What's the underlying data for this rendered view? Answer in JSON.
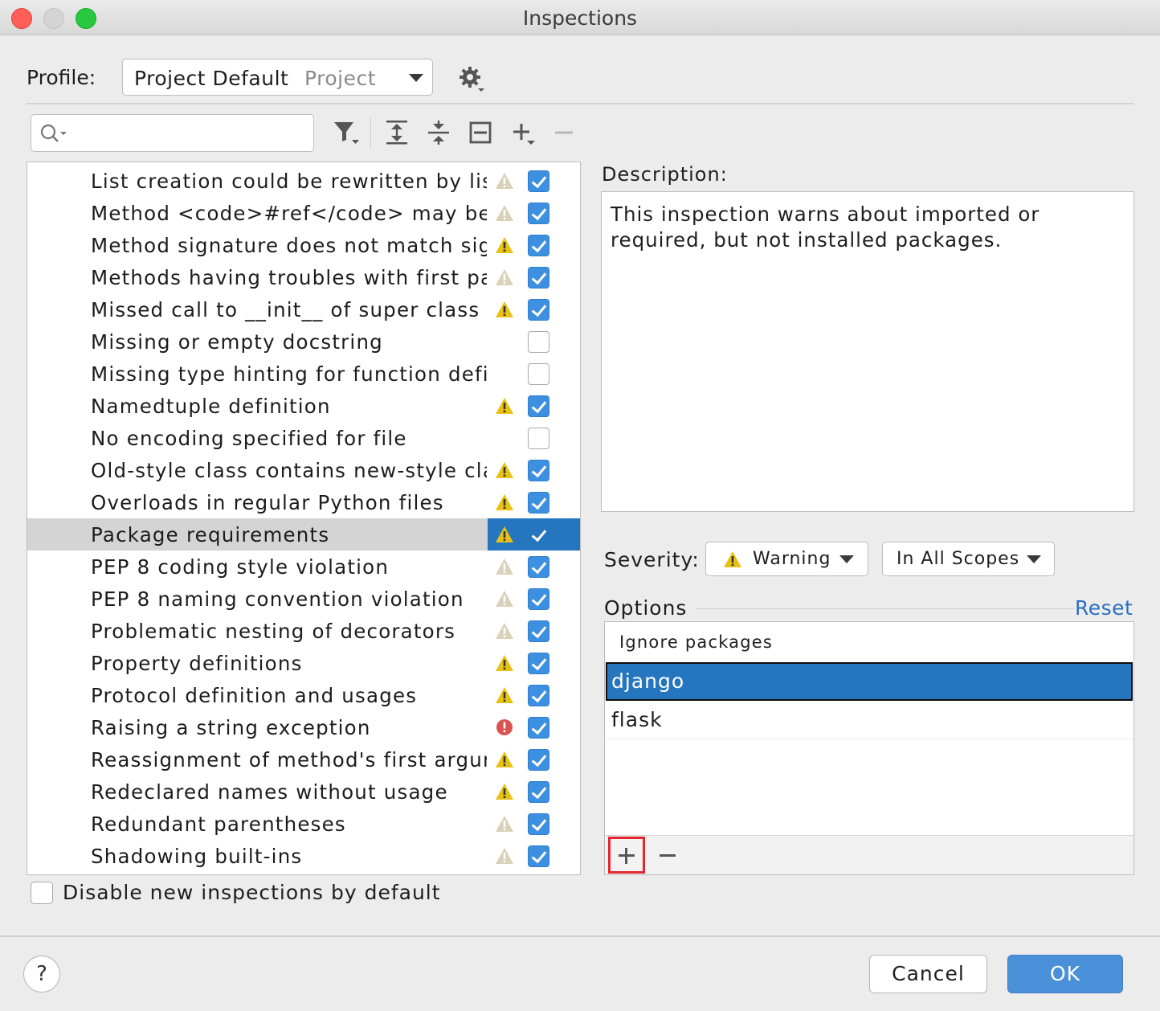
{
  "window": {
    "title": "Inspections"
  },
  "profile": {
    "label": "Profile:",
    "value": "Project Default",
    "scope": "Project"
  },
  "toolbar": {
    "search_placeholder": "",
    "icons": [
      "filter-icon",
      "expand-all-icon",
      "collapse-all-icon",
      "reset-icon",
      "add-icon",
      "remove-icon"
    ]
  },
  "inspections": [
    {
      "label": "List creation could be rewritten by list",
      "severity": "weak-warning",
      "enabled": true
    },
    {
      "label": "Method <code>#ref</code> may be 'static'",
      "severity": "weak-warning",
      "enabled": true
    },
    {
      "label": "Method signature does not match signature",
      "severity": "warning",
      "enabled": true
    },
    {
      "label": "Methods having troubles with first parameter",
      "severity": "weak-warning",
      "enabled": true
    },
    {
      "label": "Missed call to __init__ of super class",
      "severity": "warning",
      "enabled": true
    },
    {
      "label": "Missing or empty docstring",
      "severity": "none",
      "enabled": false
    },
    {
      "label": "Missing type hinting for function definition",
      "severity": "none",
      "enabled": false
    },
    {
      "label": "Namedtuple definition",
      "severity": "warning",
      "enabled": true
    },
    {
      "label": "No encoding specified for file",
      "severity": "none",
      "enabled": false
    },
    {
      "label": "Old-style class contains new-style class features",
      "severity": "warning",
      "enabled": true
    },
    {
      "label": "Overloads in regular Python files",
      "severity": "warning",
      "enabled": true
    },
    {
      "label": "Package requirements",
      "severity": "warning",
      "enabled": true,
      "selected": true
    },
    {
      "label": "PEP 8 coding style violation",
      "severity": "weak-warning",
      "enabled": true
    },
    {
      "label": "PEP 8 naming convention violation",
      "severity": "weak-warning",
      "enabled": true
    },
    {
      "label": "Problematic nesting of decorators",
      "severity": "weak-warning",
      "enabled": true
    },
    {
      "label": "Property definitions",
      "severity": "warning",
      "enabled": true
    },
    {
      "label": "Protocol definition and usages",
      "severity": "warning",
      "enabled": true
    },
    {
      "label": "Raising a string exception",
      "severity": "error",
      "enabled": true
    },
    {
      "label": "Reassignment of method's first argument",
      "severity": "warning",
      "enabled": true
    },
    {
      "label": "Redeclared names without usage",
      "severity": "warning",
      "enabled": true
    },
    {
      "label": "Redundant parentheses",
      "severity": "weak-warning",
      "enabled": true
    },
    {
      "label": "Shadowing built-ins",
      "severity": "weak-warning",
      "enabled": true
    }
  ],
  "disable_new": {
    "label": "Disable new inspections by default",
    "checked": false
  },
  "description": {
    "label": "Description:",
    "line1": "This inspection warns about imported or",
    "line2": "required, but not installed packages."
  },
  "severity": {
    "label": "Severity:",
    "value": "Warning",
    "scope": "In All Scopes"
  },
  "options": {
    "label": "Options",
    "reset": "Reset",
    "list_header": "Ignore packages",
    "packages": [
      "django",
      "flask"
    ],
    "selected_package": "django"
  },
  "footer": {
    "help": "?",
    "cancel": "Cancel",
    "ok": "OK"
  },
  "colors": {
    "accent": "#2675bf",
    "warning": "#e8c116",
    "weak_warning": "#d9d1b9",
    "error": "#d9534f",
    "highlight": "#e52530"
  }
}
